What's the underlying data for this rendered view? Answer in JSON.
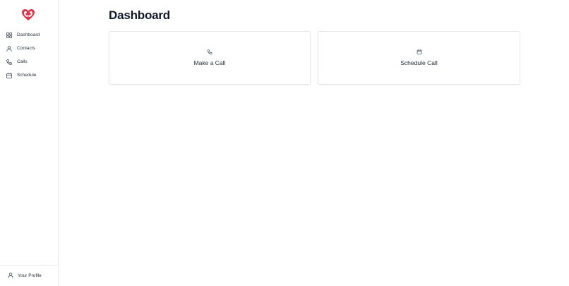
{
  "sidebar": {
    "logo": "heart-phone-logo",
    "items": [
      {
        "label": "Dashboard",
        "icon": "grid-icon"
      },
      {
        "label": "Contacts",
        "icon": "user-icon"
      },
      {
        "label": "Calls",
        "icon": "phone-icon"
      },
      {
        "label": "Schedule",
        "icon": "calendar-icon"
      }
    ],
    "profile": {
      "label": "Your Profile",
      "icon": "user-icon"
    }
  },
  "main": {
    "title": "Dashboard",
    "cards": [
      {
        "label": "Make a Call",
        "icon": "phone-icon"
      },
      {
        "label": "Schedule Call",
        "icon": "calendar-icon"
      }
    ]
  },
  "colors": {
    "brand": "#e0344b",
    "text": "#1f2937",
    "border": "#e5e7eb"
  }
}
